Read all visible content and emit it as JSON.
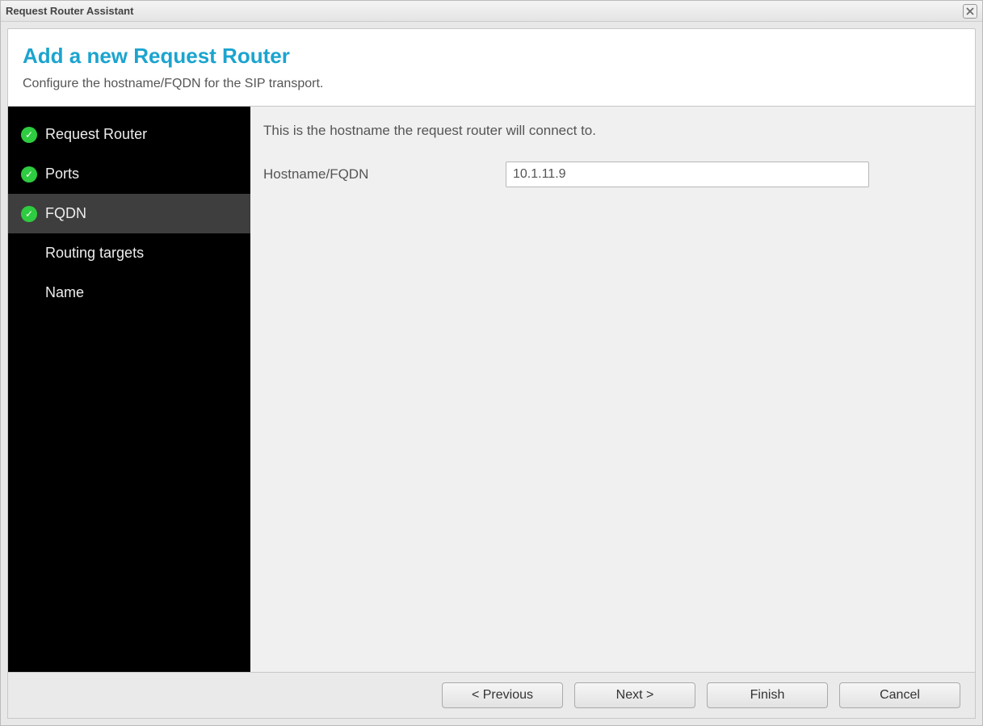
{
  "window": {
    "title": "Request Router Assistant"
  },
  "header": {
    "title": "Add a new Request Router",
    "subtitle": "Configure the hostname/FQDN for the SIP transport."
  },
  "sidebar": {
    "steps": [
      {
        "label": "Request Router",
        "checked": true,
        "active": false
      },
      {
        "label": "Ports",
        "checked": true,
        "active": false
      },
      {
        "label": "FQDN",
        "checked": true,
        "active": true
      },
      {
        "label": "Routing targets",
        "checked": false,
        "active": false
      },
      {
        "label": "Name",
        "checked": false,
        "active": false
      }
    ]
  },
  "main": {
    "description": "This is the hostname the request router will connect to.",
    "field_label": "Hostname/FQDN",
    "field_value": "10.1.11.9"
  },
  "footer": {
    "previous": "< Previous",
    "next": "Next >",
    "finish": "Finish",
    "cancel": "Cancel"
  }
}
